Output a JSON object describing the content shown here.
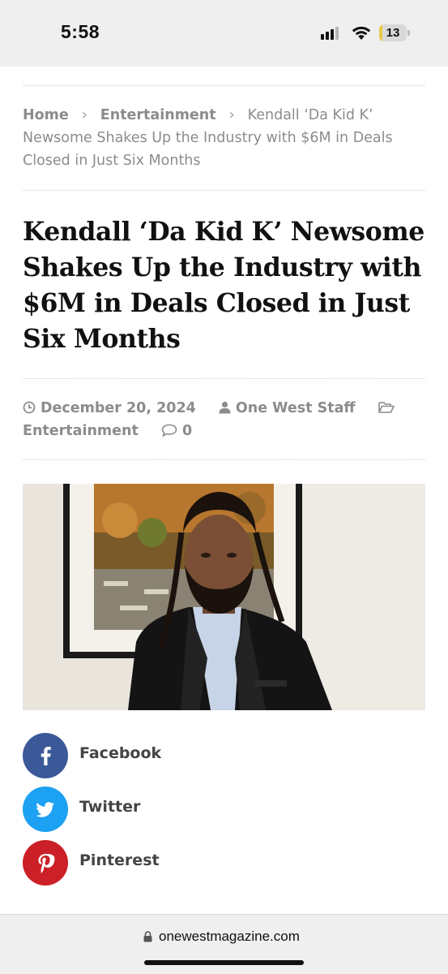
{
  "status_bar": {
    "time": "5:58",
    "battery_level": "13",
    "battery_fraction": 0.13,
    "icons": [
      "signal-icon",
      "wifi-icon",
      "battery-icon"
    ]
  },
  "breadcrumb": {
    "home": "Home",
    "category": "Entertainment",
    "current_line1": "Kendall ‘Da Kid K’",
    "current_line2": "Newsome Shakes Up the Industry with $6M in Deals",
    "current_line3": "Closed in Just Six Months",
    "separator": "›"
  },
  "article": {
    "title": "Kendall ‘Da Kid K’ Newsome Shakes Up the Industry with $6M in Deals Closed in Just Six Months",
    "date": "December 20, 2024",
    "author": "One West Staff",
    "category": "Entertainment",
    "comments": "0"
  },
  "share": {
    "facebook": "Facebook",
    "twitter": "Twitter",
    "pinterest": "Pinterest",
    "colors": {
      "facebook": "#3b5998",
      "twitter": "#1da1f2",
      "pinterest": "#cb2027"
    }
  },
  "browser": {
    "url": "onewestmagazine.com"
  }
}
